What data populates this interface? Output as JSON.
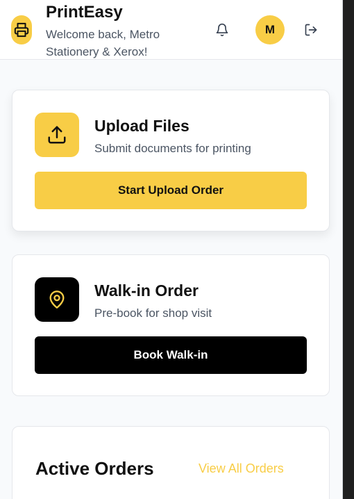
{
  "header": {
    "app_title": "PrintEasy",
    "welcome_text": "Welcome back, Metro Stationery & Xerox!",
    "avatar_initial": "M",
    "logo_icon": "printer-icon",
    "notification_icon": "bell-icon",
    "logout_icon": "logout-icon"
  },
  "upload_card": {
    "icon": "upload-icon",
    "title": "Upload Files",
    "subtitle": "Submit documents for printing",
    "button_label": "Start Upload Order"
  },
  "walkin_card": {
    "icon": "map-pin-icon",
    "title": "Walk-in Order",
    "subtitle": "Pre-book for shop visit",
    "button_label": "Book Walk-in"
  },
  "orders_card": {
    "title": "Active Orders",
    "view_all_label": "View All Orders"
  },
  "colors": {
    "accent": "#f8cd46",
    "dark": "#000000",
    "background": "#f8fafc",
    "muted_text": "#4b5563"
  }
}
